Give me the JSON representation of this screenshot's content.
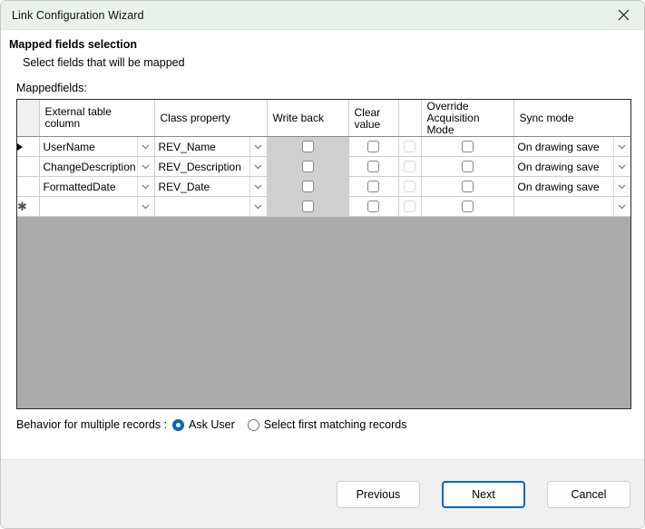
{
  "window": {
    "title": "Link Configuration Wizard",
    "close_icon": "close-icon"
  },
  "header": {
    "title": "Mapped fields selection",
    "subtitle": "Select fields that will be mapped"
  },
  "grid": {
    "label": "Mappedfields:",
    "columns": [
      {
        "key": "rowhdr",
        "label": ""
      },
      {
        "key": "external",
        "label": "External table column"
      },
      {
        "key": "classprop",
        "label": "Class property"
      },
      {
        "key": "writeback",
        "label": "Write back"
      },
      {
        "key": "clearvalue",
        "label": "Clear value"
      },
      {
        "key": "unnamed",
        "label": ""
      },
      {
        "key": "override",
        "label": "Override Acquisition Mode"
      },
      {
        "key": "syncmode",
        "label": "Sync mode"
      }
    ],
    "rows": [
      {
        "marker": "current",
        "external": "UserName",
        "classprop": "REV_Name",
        "writeback": false,
        "clearvalue": false,
        "unnamed": false,
        "override": false,
        "syncmode": "On drawing save"
      },
      {
        "marker": "",
        "external": "ChangeDescription",
        "classprop": "REV_Description",
        "writeback": false,
        "clearvalue": false,
        "unnamed": false,
        "override": false,
        "syncmode": "On drawing save"
      },
      {
        "marker": "",
        "external": "FormattedDate",
        "classprop": "REV_Date",
        "writeback": false,
        "clearvalue": false,
        "unnamed": false,
        "override": false,
        "syncmode": "On drawing save"
      },
      {
        "marker": "new",
        "external": "",
        "classprop": "",
        "writeback": false,
        "clearvalue": false,
        "unnamed": false,
        "override": false,
        "syncmode": ""
      }
    ]
  },
  "behavior": {
    "label": "Behavior for multiple records :",
    "options": [
      {
        "label": "Ask User",
        "selected": true
      },
      {
        "label": "Select first matching records",
        "selected": false
      }
    ]
  },
  "footer": {
    "previous_label": "Previous",
    "next_label": "Next",
    "cancel_label": "Cancel"
  },
  "colors": {
    "titlebar_bg": "#e9f3e9",
    "accent": "#0067c0",
    "grid_empty_bg": "#ababab",
    "writeback_col_bg": "#d0d0d0",
    "footer_bg": "#f0f0f0"
  }
}
